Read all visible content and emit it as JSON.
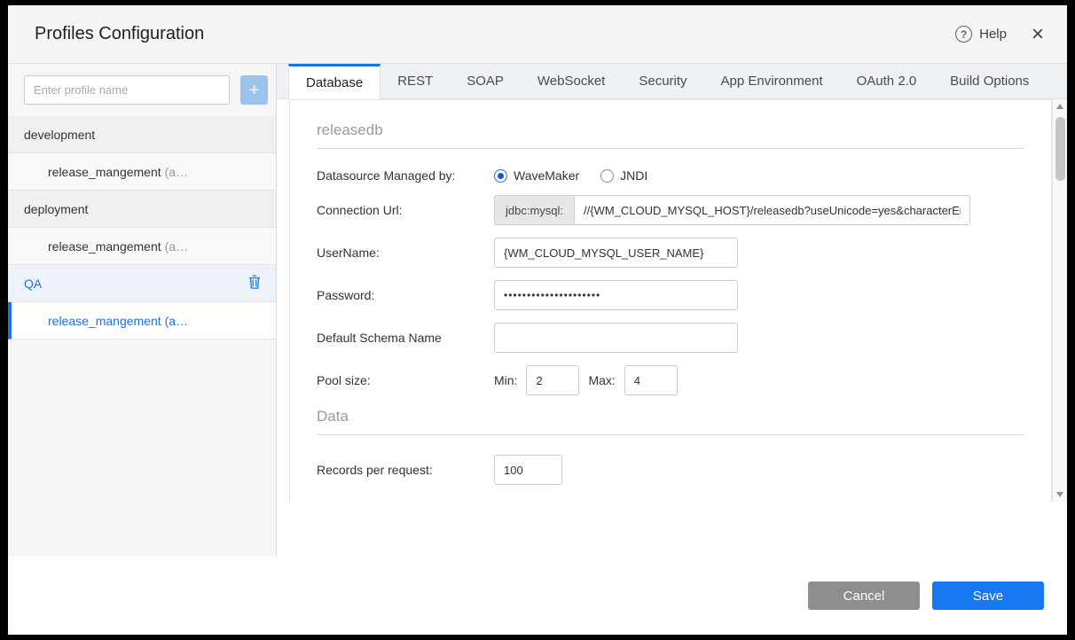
{
  "header": {
    "title": "Profiles Configuration",
    "help_label": "Help",
    "help_icon": "?",
    "close_icon": "×"
  },
  "sidebar": {
    "search_placeholder": "Enter profile name",
    "add_label": "+",
    "items": [
      {
        "label": "development",
        "type": "group"
      },
      {
        "label": "release_mangement",
        "suffix": "(a…",
        "type": "child"
      },
      {
        "label": "deployment",
        "type": "group"
      },
      {
        "label": "release_mangement",
        "suffix": "(a…",
        "type": "child"
      },
      {
        "label": "QA",
        "type": "group",
        "selected": true
      },
      {
        "label": "release_mangement",
        "suffix": "(a…",
        "type": "child",
        "selected": true
      }
    ]
  },
  "tabs": {
    "active": "Database",
    "items": [
      {
        "label": "Database"
      },
      {
        "label": "REST"
      },
      {
        "label": "SOAP"
      },
      {
        "label": "WebSocket"
      },
      {
        "label": "Security"
      },
      {
        "label": "App Environment"
      },
      {
        "label": "OAuth 2.0"
      },
      {
        "label": "Build Options"
      }
    ]
  },
  "form": {
    "section_title": "releasedb",
    "datasource_label": "Datasource Managed by:",
    "radio_wavemaker": "WaveMaker",
    "radio_jndi": "JNDI",
    "datasource_selected": "WaveMaker",
    "connection_label": "Connection Url:",
    "connection_prefix": "jdbc:mysql:",
    "connection_value": "//{WM_CLOUD_MYSQL_HOST}/releasedb?useUnicode=yes&characterEn",
    "username_label": "UserName:",
    "username_value": "{WM_CLOUD_MYSQL_USER_NAME}",
    "password_label": "Password:",
    "password_value": "•••••••••••••••••••••",
    "schema_label": "Default Schema Name",
    "schema_value": "",
    "pool_label": "Pool size:",
    "min_label": "Min:",
    "min_value": "2",
    "max_label": "Max:",
    "max_value": "4",
    "data_section_title": "Data",
    "records_label": "Records per request:",
    "records_value": "100"
  },
  "footer": {
    "cancel_label": "Cancel",
    "save_label": "Save"
  },
  "colors": {
    "accent": "#1a73e8",
    "save_button": "#1778f2",
    "cancel_button": "#8e8e8e",
    "add_button": "#9cc3ee"
  }
}
